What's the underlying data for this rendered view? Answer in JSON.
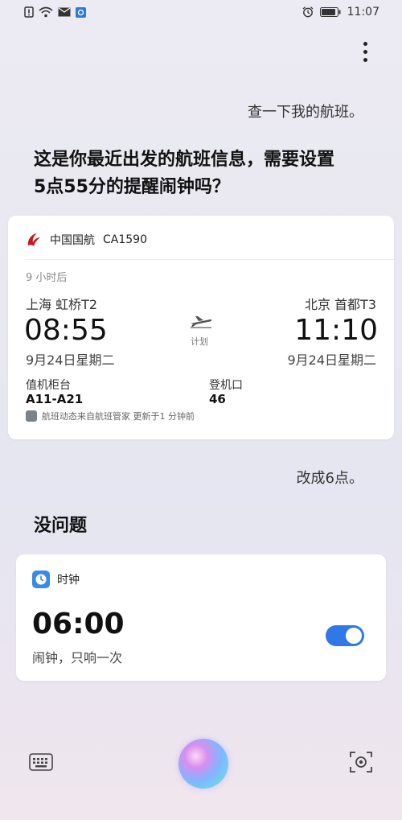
{
  "status_bar": {
    "time": "11:07"
  },
  "conversation": {
    "user_query_1": "查一下我的航班。",
    "assistant_reply_1": "这是你最近出发的航班信息，需要设置5点55分的提醒闹钟吗？",
    "user_query_2": "改成6点。",
    "assistant_reply_2": "没问题"
  },
  "flight_card": {
    "airline": "中国国航",
    "flight_number": "CA1590",
    "eta_text": "9 小时后",
    "departure": {
      "city": "上海 虹桥T2",
      "time": "08:55",
      "date": "9月24日星期二"
    },
    "arrival": {
      "city": "北京 首都T3",
      "time": "11:10",
      "date": "9月24日星期二"
    },
    "status": "计划",
    "checkin_counter_label": "值机柜台",
    "checkin_counter_value": "A11-A21",
    "gate_label": "登机口",
    "gate_value": "46",
    "source_note": "航班动态来自航班管家 更新于1 分钟前",
    "brand_color": "#d0121b"
  },
  "alarm_card": {
    "app_name": "时钟",
    "time": "06:00",
    "description": "闹钟，只响一次",
    "enabled": true,
    "toggle_color": "#2f78e6"
  },
  "icons": [
    "alert-icon",
    "wifi-icon",
    "mail-icon",
    "app-icon",
    "alarm-icon",
    "battery-icon",
    "more-icon",
    "keyboard-icon",
    "voice-assistant-orb",
    "lens-icon"
  ]
}
